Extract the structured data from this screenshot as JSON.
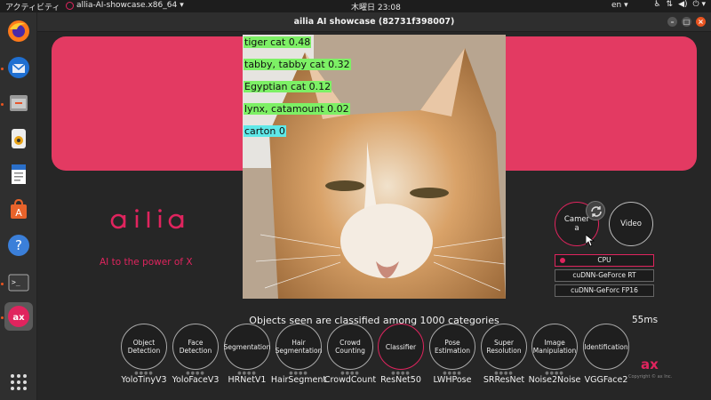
{
  "topbar": {
    "activities": "アクティビティ",
    "app_menu": "allia-AI-showcase.x86_64",
    "clock": "木曜日 23:08",
    "lang": "en",
    "tray_icons": [
      "accessibility-icon",
      "network-icon",
      "volume-icon",
      "power-icon"
    ]
  },
  "dock": {
    "items": [
      "firefox-icon",
      "thunderbird-icon",
      "files-icon",
      "rhythmbox-icon",
      "libreoffice-writer-icon",
      "software-center-icon",
      "help-icon",
      "terminal-icon",
      "ailia-icon",
      "apps-grid-icon"
    ]
  },
  "window": {
    "title": "ailia AI showcase (82731f398007)"
  },
  "brand": {
    "tagline": "AI to the power of X",
    "accent": "#e0245e",
    "banner_color": "#e33a62"
  },
  "detections": [
    {
      "label": "tiger cat 0.48",
      "color": "#7df065"
    },
    {
      "label": "tabby, tabby cat 0.32",
      "color": "#7df065"
    },
    {
      "label": "Egyptian cat 0.12",
      "color": "#7df065"
    },
    {
      "label": "lynx, catamount 0.02",
      "color": "#7df065"
    },
    {
      "label": "carton 0",
      "color": "#5ee8e8"
    }
  ],
  "caption": "Objects seen are classified among 1000 categories",
  "fps": "55ms",
  "source": {
    "camera": "Camer\na",
    "video": "Video"
  },
  "devices": [
    {
      "label": "CPU",
      "selected": true
    },
    {
      "label": "cuDNN-GeForce RT",
      "selected": false
    },
    {
      "label": "cuDNN-GeForc FP16",
      "selected": false
    }
  ],
  "models": [
    {
      "category": "Object\nDetection",
      "name": "YoloTinyV3",
      "active": false
    },
    {
      "category": "Face\nDetection",
      "name": "YoloFaceV3",
      "active": false
    },
    {
      "category": "Segmentation",
      "name": "HRNetV1",
      "active": false
    },
    {
      "category": "Hair\nSegmentation",
      "name": "HairSegment",
      "active": false
    },
    {
      "category": "Crowd\nCounting",
      "name": "CrowdCount",
      "active": false
    },
    {
      "category": "Classifier",
      "name": "ResNet50",
      "active": true
    },
    {
      "category": "Pose\nEstimation",
      "name": "LWHPose",
      "active": false
    },
    {
      "category": "Super\nResolution",
      "name": "SRResNet",
      "active": false
    },
    {
      "category": "Image\nManipulation",
      "name": "Noise2Noise",
      "active": false
    },
    {
      "category": "Identification",
      "name": "VGGFace2",
      "active": false
    }
  ],
  "corner": {
    "copyright": "Copyright © ax Inc."
  }
}
